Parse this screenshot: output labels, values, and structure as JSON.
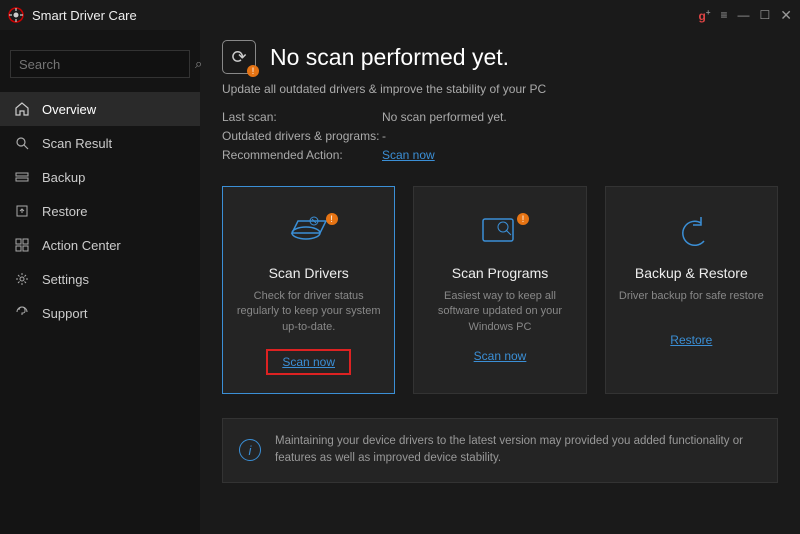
{
  "titlebar": {
    "title": "Smart Driver Care"
  },
  "search": {
    "placeholder": "Search"
  },
  "sidebar": {
    "items": [
      {
        "label": "Overview",
        "icon": "home"
      },
      {
        "label": "Scan Result",
        "icon": "scan"
      },
      {
        "label": "Backup",
        "icon": "backup"
      },
      {
        "label": "Restore",
        "icon": "restore"
      },
      {
        "label": "Action Center",
        "icon": "grid"
      },
      {
        "label": "Settings",
        "icon": "gear"
      },
      {
        "label": "Support",
        "icon": "support"
      }
    ]
  },
  "header": {
    "title": "No scan performed yet."
  },
  "subtitle": "Update all outdated drivers & improve the stability of your PC",
  "info": {
    "last_scan_label": "Last scan:",
    "last_scan_value": "No scan performed yet.",
    "outdated_label": "Outdated drivers & programs:",
    "outdated_value": "-",
    "recommended_label": "Recommended Action:",
    "recommended_value": "Scan now"
  },
  "cards": [
    {
      "title": "Scan Drivers",
      "desc": "Check for driver status regularly to keep your system up-to-date.",
      "action": "Scan now"
    },
    {
      "title": "Scan Programs",
      "desc": "Easiest way to keep all software updated on your Windows PC",
      "action": "Scan now"
    },
    {
      "title": "Backup & Restore",
      "desc": "Driver backup for safe restore",
      "action": "Restore"
    }
  ],
  "banner": {
    "text": "Maintaining your device drivers to the latest version may provided you added functionality or features as well as improved device stability."
  }
}
